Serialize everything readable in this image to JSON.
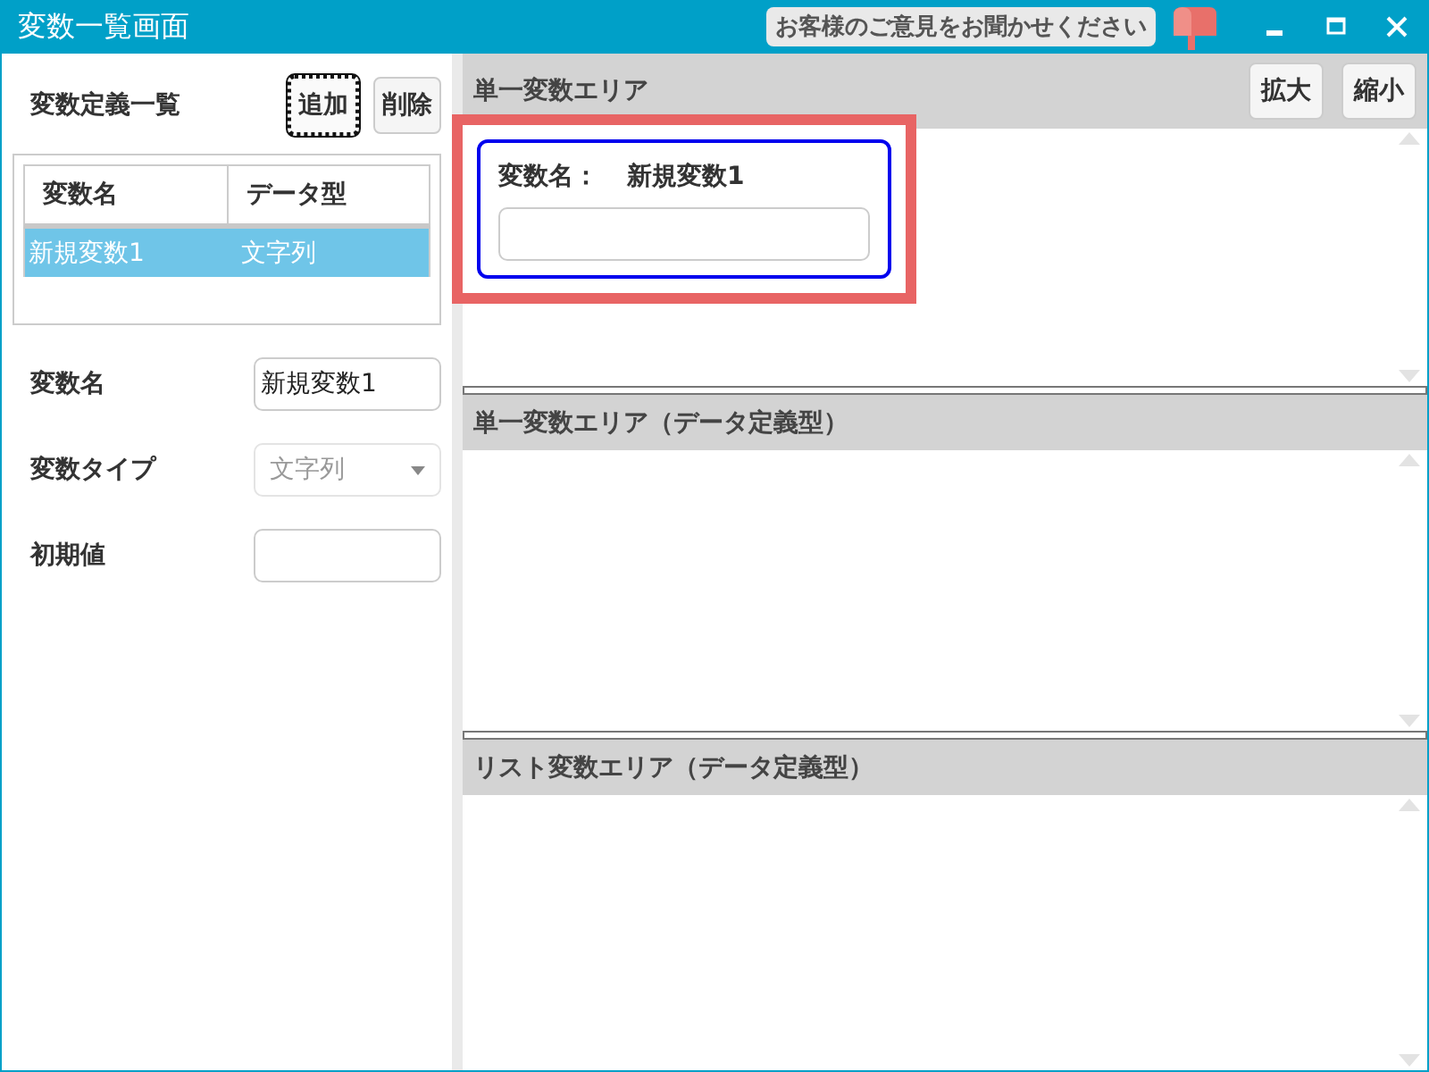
{
  "window": {
    "title": "変数一覧画面"
  },
  "feedback": {
    "label": "お客様のご意見をお聞かせください"
  },
  "left": {
    "heading": "変数定義一覧",
    "buttons": [
      {
        "label": "追加",
        "focused": true
      },
      {
        "label": "削除",
        "focused": false
      }
    ],
    "table": {
      "columns": [
        "変数名",
        "データ型"
      ],
      "rows": [
        {
          "cells": [
            "新規変数1",
            "文字列"
          ],
          "selected": true
        }
      ]
    },
    "fields": [
      {
        "label": "変数名",
        "kind": "text",
        "value": "新規変数1",
        "disabled": false
      },
      {
        "label": "変数タイプ",
        "kind": "select",
        "value": "文字列",
        "disabled": true
      },
      {
        "label": "初期値",
        "kind": "text",
        "disabled": false
      }
    ]
  },
  "panels": [
    {
      "title": "単一変数エリア",
      "buttons": [
        "拡大",
        "縮小"
      ],
      "card": {
        "label": "変数名：",
        "value": "新規変数1",
        "highlighted": true
      }
    },
    {
      "title": "単一変数エリア（データ定義型）"
    },
    {
      "title": "リスト変数エリア（データ定義型）"
    }
  ]
}
